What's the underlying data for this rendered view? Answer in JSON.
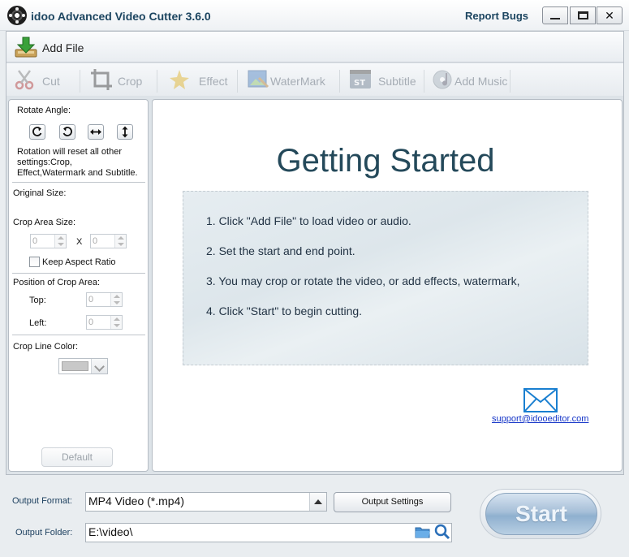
{
  "window": {
    "title": "idoo Advanced Video Cutter 3.6.0",
    "report_bugs": "Report Bugs",
    "minimize_icon": "minimize-icon",
    "maximize_icon": "maximize-icon",
    "close_icon": "close-icon",
    "close_glyph": "✕"
  },
  "toolbar": {
    "add_file": "Add File",
    "tools": [
      {
        "label": "Cut",
        "icon": "scissors-icon"
      },
      {
        "label": "Crop",
        "icon": "crop-icon"
      },
      {
        "label": "Effect",
        "icon": "sparkle-icon"
      },
      {
        "label": "WaterMark",
        "icon": "watermark-icon"
      },
      {
        "label": "Subtitle",
        "icon": "subtitle-icon"
      },
      {
        "label": "Add Music",
        "icon": "music-disc-icon"
      }
    ]
  },
  "left_panel": {
    "rotate_angle": "Rotate Angle:",
    "rotate_buttons": [
      "rotate-clockwise-icon",
      "rotate-counterclockwise-icon",
      "flip-horizontal-icon",
      "flip-vertical-icon"
    ],
    "rotation_note": [
      "Rotation will reset all other",
      "settings:Crop,",
      "Effect,Watermark and Subtitle."
    ],
    "original_size": "Original Size:",
    "crop_area_size": "Crop Area Size:",
    "crop_width": "0",
    "crop_x": "X",
    "crop_height": "0",
    "keep_aspect_ratio": "Keep Aspect Ratio",
    "position_of_crop_area": "Position of Crop Area:",
    "top_label": "Top:",
    "top_value": "0",
    "left_label": "Left:",
    "left_value": "0",
    "crop_line_color": "Crop Line Color:",
    "crop_line_color_value": "#c8c8c8",
    "default_button": "Default"
  },
  "main": {
    "title": "Getting Started",
    "steps": [
      "1. Click \"Add File\" to load video or audio.",
      "2. Set the start and end point.",
      "3. You may crop or rotate the video, or add effects, watermark,",
      "4. Click \"Start\" to begin cutting."
    ],
    "support_email": "support@idooeditor.com"
  },
  "bottom": {
    "output_format_label": "Output Format:",
    "output_format_value": "MP4 Video (*.mp4)",
    "output_settings_button": "Output Settings",
    "output_folder_label": "Output Folder:",
    "output_folder_value": "E:\\video\\",
    "start_button": "Start"
  }
}
